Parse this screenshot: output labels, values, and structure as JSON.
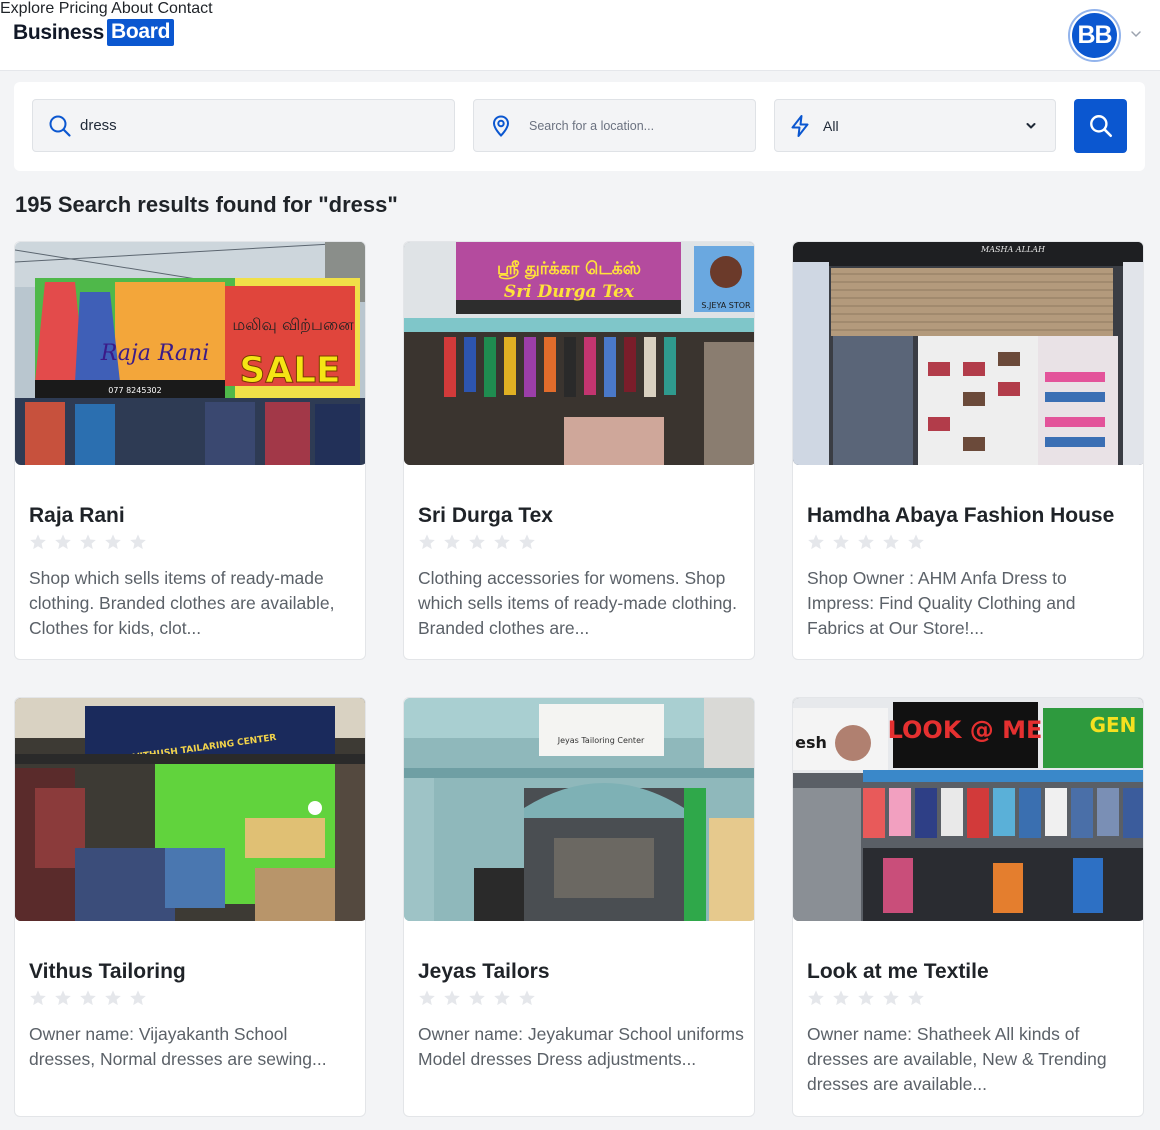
{
  "header": {
    "logo_part1": "Business",
    "logo_part2": "Board",
    "nav": [
      "Explore",
      "Pricing",
      "About",
      "Contact"
    ],
    "avatar_initials": "BB"
  },
  "search": {
    "query_value": "dress",
    "location_placeholder": "Search for a location...",
    "category_value": "All"
  },
  "results": {
    "title": "195 Search results found for \"dress\"",
    "cards": [
      {
        "name": "Raja Rani",
        "rating": 0,
        "description": "Shop which sells items of ready-made clothing. Branded clothes are available, Clothes for kids, clot...",
        "sign_main": "Raja Rani",
        "sign_tamil": "மலிவு விற்பனை",
        "sign_extra": "SALE",
        "sign_phone": "077 8245302"
      },
      {
        "name": "Sri Durga Tex",
        "rating": 0,
        "description": "Clothing accessories for womens. Shop which sells items of ready-made clothing. Branded clothes are...",
        "sign_main": "Sri Durga Tex",
        "sign_tamil": "ஸ்ரீ துர்க்கா டெக்ஸ்",
        "sign_extra": "S.JEYA STOR"
      },
      {
        "name": "Hamdha Abaya Fashion House",
        "rating": 0,
        "description": "Shop Owner : AHM Anfa Dress to Impress: Find Quality Clothing and Fabrics at Our Store!...",
        "sign_main": "MASHA ALLAH"
      },
      {
        "name": "Vithus Tailoring",
        "rating": 0,
        "description": "Owner name: Vijayakanth School dresses, Normal dresses are sewing...",
        "sign_main": "VITHUSH TAILARING CENTER"
      },
      {
        "name": "Jeyas Tailors",
        "rating": 0,
        "description": "Owner name: Jeyakumar School uniforms Model dresses Dress adjustments...",
        "sign_main": "Jeyas Tailoring Center"
      },
      {
        "name": "Look at me Textile",
        "rating": 0,
        "description": "Owner name: Shatheek All kinds of dresses are available, New & Trending dresses are available...",
        "sign_main": "LOOK @ ME",
        "sign_extra": "GEN",
        "sign_side": "esh"
      }
    ]
  },
  "colors": {
    "brand": "#0b57d0",
    "star_empty": "#e5e7eb"
  }
}
